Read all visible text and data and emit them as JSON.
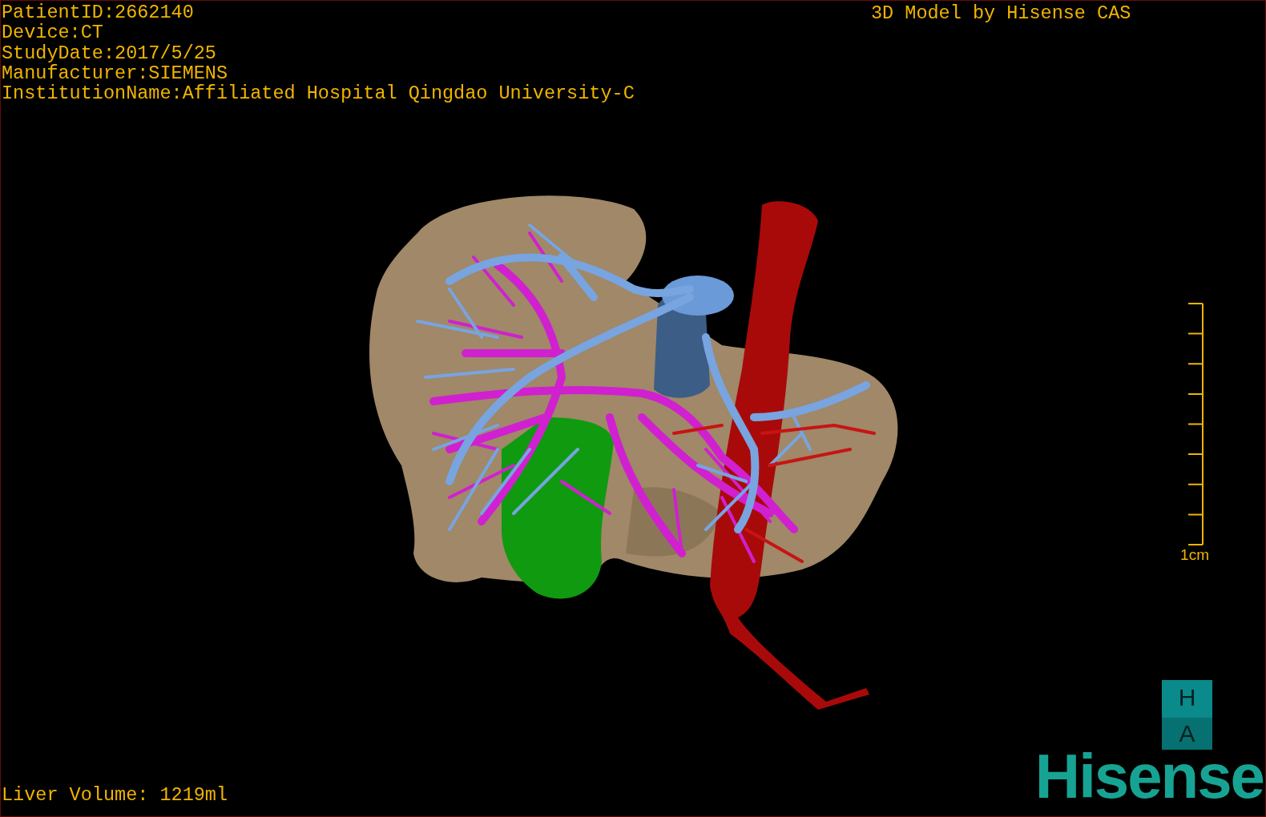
{
  "info_lines": [
    "PatientID:2662140",
    "Device:CT",
    "StudyDate:2017/5/25",
    "Manufacturer:SIEMENS",
    "InstitutionName:Affiliated Hospital Qingdao University-C"
  ],
  "title": "3D Model by Hisense CAS",
  "scale_bar": {
    "label": "1cm"
  },
  "orientation": {
    "top": "H",
    "bottom": "A"
  },
  "brand": "Hisense",
  "liver_volume": "Liver Volume: 1219ml"
}
